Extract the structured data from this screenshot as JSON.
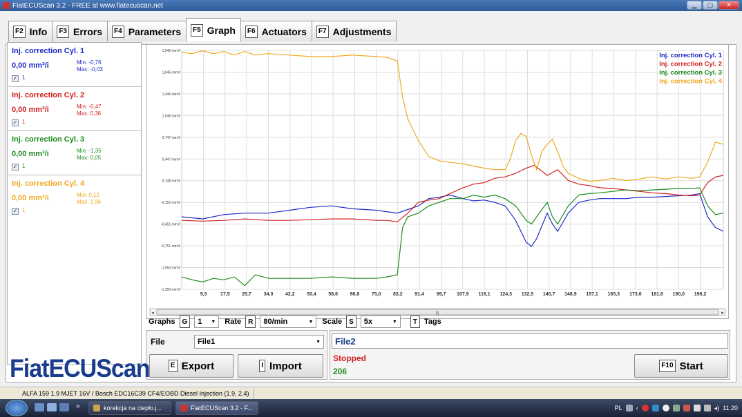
{
  "window": {
    "title": "FiatECUScan 3.2 - FREE at www.fiatecuscan.net"
  },
  "tabs": [
    {
      "key": "F2",
      "label": "Info"
    },
    {
      "key": "F3",
      "label": "Errors"
    },
    {
      "key": "F4",
      "label": "Parameters"
    },
    {
      "key": "F5",
      "label": "Graph"
    },
    {
      "key": "F6",
      "label": "Actuators"
    },
    {
      "key": "F7",
      "label": "Adjustments"
    }
  ],
  "channels": [
    {
      "name": "Inj. correction Cyl. 1",
      "value": "0,00 mm³/i",
      "min": "Min: -0,76",
      "max": "Max: -0,03",
      "checkbox_label": "1",
      "color": "#1e28c8"
    },
    {
      "name": "Inj. correction Cyl. 2",
      "value": "0,00 mm³/i",
      "min": "Min: -0,47",
      "max": "Max: 0,36",
      "checkbox_label": "1",
      "color": "#d21e1e"
    },
    {
      "name": "Inj. correction Cyl. 3",
      "value": "0,00 mm³/i",
      "min": "Min: -1,35",
      "max": "Max: 0,05",
      "checkbox_label": "1",
      "color": "#1e8c1e"
    },
    {
      "name": "Inj. correction Cyl. 4",
      "value": "0,00 mm³/i",
      "min": "Min: 0,12",
      "max": "Max: 1,96",
      "checkbox_label": "1",
      "color": "#f0a81e"
    }
  ],
  "chart_data": {
    "type": "line",
    "title": "",
    "xlabel": "",
    "ylabel": "",
    "ylim": [
      -1.35,
      1.945
    ],
    "xlim": [
      1.0,
      207.0
    ],
    "grid": true,
    "legend_position": "top-right",
    "y_ticks": [
      "1,945 mm³/i",
      "1,645 mm³/i",
      "1,346 mm³/i",
      "1,046 mm³/i",
      "0,747 mm³/i",
      "0,447 mm³/i",
      "0,148 mm³/i",
      "-0,152 mm³/i",
      "-0,451 mm³/i",
      "-0,751 mm³/i",
      "-1,050 mm³/i",
      "-1,350 mm³/i"
    ],
    "y_tick_values": [
      1.945,
      1.645,
      1.346,
      1.046,
      0.747,
      0.447,
      0.148,
      -0.152,
      -0.451,
      -0.751,
      -1.05,
      -1.35
    ],
    "x_ticks": [
      "9,3",
      "17,5",
      "25,7",
      "34,0",
      "42,2",
      "50,4",
      "58,6",
      "66,8",
      "75,0",
      "83,2",
      "91,4",
      "99,7",
      "107,9",
      "116,1",
      "124,3",
      "132,5",
      "140,7",
      "148,9",
      "157,1",
      "165,3",
      "173,6",
      "181,8",
      "190,0",
      "198,2"
    ],
    "x_tick_values": [
      9.3,
      17.5,
      25.7,
      34.0,
      42.2,
      50.4,
      58.6,
      66.8,
      75.0,
      83.2,
      91.4,
      99.7,
      107.9,
      116.1,
      124.3,
      132.5,
      140.7,
      148.9,
      157.1,
      165.3,
      173.6,
      181.8,
      190.0,
      198.2
    ],
    "series": [
      {
        "name": "Inj. correction Cyl. 1",
        "color": "#1e28c8",
        "x": [
          1,
          9,
          17,
          25,
          34,
          42,
          50,
          58,
          66,
          75,
          79,
          83,
          87,
          91,
          95,
          99,
          103,
          108,
          112,
          116,
          120,
          124,
          128,
          132,
          134,
          136,
          140,
          142,
          144,
          148,
          152,
          156,
          160,
          165,
          170,
          175,
          180,
          185,
          190,
          195,
          198,
          201,
          204,
          207
        ],
        "y": [
          -0.35,
          -0.38,
          -0.32,
          -0.3,
          -0.3,
          -0.26,
          -0.22,
          -0.2,
          -0.24,
          -0.26,
          -0.28,
          -0.3,
          -0.25,
          -0.2,
          -0.1,
          -0.08,
          -0.05,
          -0.1,
          -0.13,
          -0.12,
          -0.15,
          -0.2,
          -0.4,
          -0.7,
          -0.76,
          -0.65,
          -0.3,
          -0.45,
          -0.55,
          -0.3,
          -0.15,
          -0.12,
          -0.1,
          -0.1,
          -0.1,
          -0.08,
          -0.08,
          -0.07,
          -0.06,
          -0.05,
          -0.03,
          -0.35,
          -0.5,
          -0.55
        ]
      },
      {
        "name": "Inj. correction Cyl. 2",
        "color": "#d21e1e",
        "x": [
          1,
          9,
          17,
          25,
          34,
          42,
          50,
          58,
          66,
          75,
          79,
          83,
          87,
          91,
          95,
          99,
          103,
          108,
          112,
          116,
          120,
          124,
          128,
          132,
          135,
          138,
          140,
          144,
          148,
          152,
          156,
          160,
          165,
          170,
          175,
          180,
          185,
          190,
          195,
          198,
          201,
          204,
          207
        ],
        "y": [
          -0.4,
          -0.41,
          -0.4,
          -0.38,
          -0.4,
          -0.4,
          -0.39,
          -0.38,
          -0.38,
          -0.4,
          -0.4,
          -0.42,
          -0.3,
          -0.15,
          -0.12,
          -0.1,
          -0.03,
          0.05,
          0.1,
          0.12,
          0.18,
          0.2,
          0.25,
          0.32,
          0.36,
          0.28,
          0.22,
          0.3,
          0.15,
          0.1,
          0.08,
          0.05,
          0.04,
          0.02,
          0.0,
          -0.02,
          -0.03,
          -0.05,
          -0.06,
          -0.05,
          0.12,
          0.2,
          0.22
        ]
      },
      {
        "name": "Inj. correction Cyl. 3",
        "color": "#1e8c1e",
        "x": [
          1,
          5,
          9,
          13,
          17,
          21,
          25,
          29,
          34,
          42,
          50,
          58,
          66,
          75,
          79,
          83,
          85,
          87,
          91,
          95,
          99,
          103,
          108,
          112,
          116,
          120,
          124,
          128,
          132,
          134,
          136,
          140,
          142,
          144,
          148,
          152,
          156,
          160,
          165,
          170,
          175,
          180,
          185,
          190,
          195,
          198,
          201,
          204,
          207
        ],
        "y": [
          -1.18,
          -1.22,
          -1.25,
          -1.2,
          -1.22,
          -1.18,
          -1.3,
          -1.15,
          -1.2,
          -1.2,
          -1.2,
          -1.18,
          -1.2,
          -1.2,
          -1.18,
          -1.15,
          -0.5,
          -0.35,
          -0.3,
          -0.2,
          -0.15,
          -0.1,
          -0.1,
          -0.05,
          -0.08,
          -0.05,
          -0.1,
          -0.2,
          -0.4,
          -0.45,
          -0.35,
          -0.15,
          -0.35,
          -0.45,
          -0.2,
          -0.05,
          -0.03,
          -0.02,
          0.0,
          0.02,
          0.01,
          0.02,
          0.03,
          0.04,
          0.04,
          0.05,
          -0.2,
          -0.32,
          -0.3
        ]
      },
      {
        "name": "Inj. correction Cyl. 4",
        "color": "#f0a81e",
        "x": [
          1,
          5,
          9,
          13,
          17,
          21,
          25,
          29,
          34,
          42,
          50,
          58,
          66,
          75,
          79,
          83,
          85,
          87,
          91,
          95,
          99,
          103,
          108,
          112,
          116,
          120,
          124,
          126,
          128,
          130,
          132,
          134,
          136,
          138,
          140,
          142,
          144,
          146,
          148,
          152,
          156,
          160,
          165,
          170,
          175,
          180,
          185,
          190,
          195,
          198,
          201,
          204,
          207
        ],
        "y": [
          1.92,
          1.9,
          1.94,
          1.9,
          1.93,
          1.88,
          1.93,
          1.88,
          1.9,
          1.88,
          1.86,
          1.86,
          1.88,
          1.86,
          1.85,
          1.8,
          1.3,
          1.0,
          0.7,
          0.48,
          0.42,
          0.4,
          0.38,
          0.35,
          0.32,
          0.3,
          0.3,
          0.45,
          0.7,
          0.8,
          0.76,
          0.5,
          0.3,
          0.55,
          0.65,
          0.72,
          0.55,
          0.35,
          0.25,
          0.18,
          0.14,
          0.15,
          0.18,
          0.15,
          0.17,
          0.2,
          0.17,
          0.2,
          0.18,
          0.2,
          0.4,
          0.68,
          0.65
        ]
      }
    ]
  },
  "controls": {
    "graphs_label": "Graphs",
    "graphs_key": "G",
    "graphs_value": "1",
    "rate_label": "Rate",
    "rate_key": "R",
    "rate_value": "80/min",
    "scale_label": "Scale",
    "scale_key": "S",
    "scale_value": "5x",
    "tags_key": "T",
    "tags_label": "Tags"
  },
  "file": {
    "label": "File",
    "value": "File1",
    "export_key": "E",
    "export_label": "Export",
    "import_key": "I",
    "import_label": "Import",
    "file2": "File2",
    "status": "Stopped",
    "count": "206",
    "start_key": "F10",
    "start_label": "Start",
    "status_color": "#d21e1e",
    "count_color": "#1e8c1e"
  },
  "logo": "FiatECUScan",
  "statusbar": {
    "vehicle": "ALFA 159 1.9 MJET 16V / Bosch EDC16C39 CF4/EOBD Diesel Injection (1.9, 2.4)"
  },
  "taskbar": {
    "items": [
      "korekcja na ciepło.j...",
      "FiatECUScan 3.2 - F..."
    ],
    "lang": "PL",
    "time": "11:20"
  }
}
